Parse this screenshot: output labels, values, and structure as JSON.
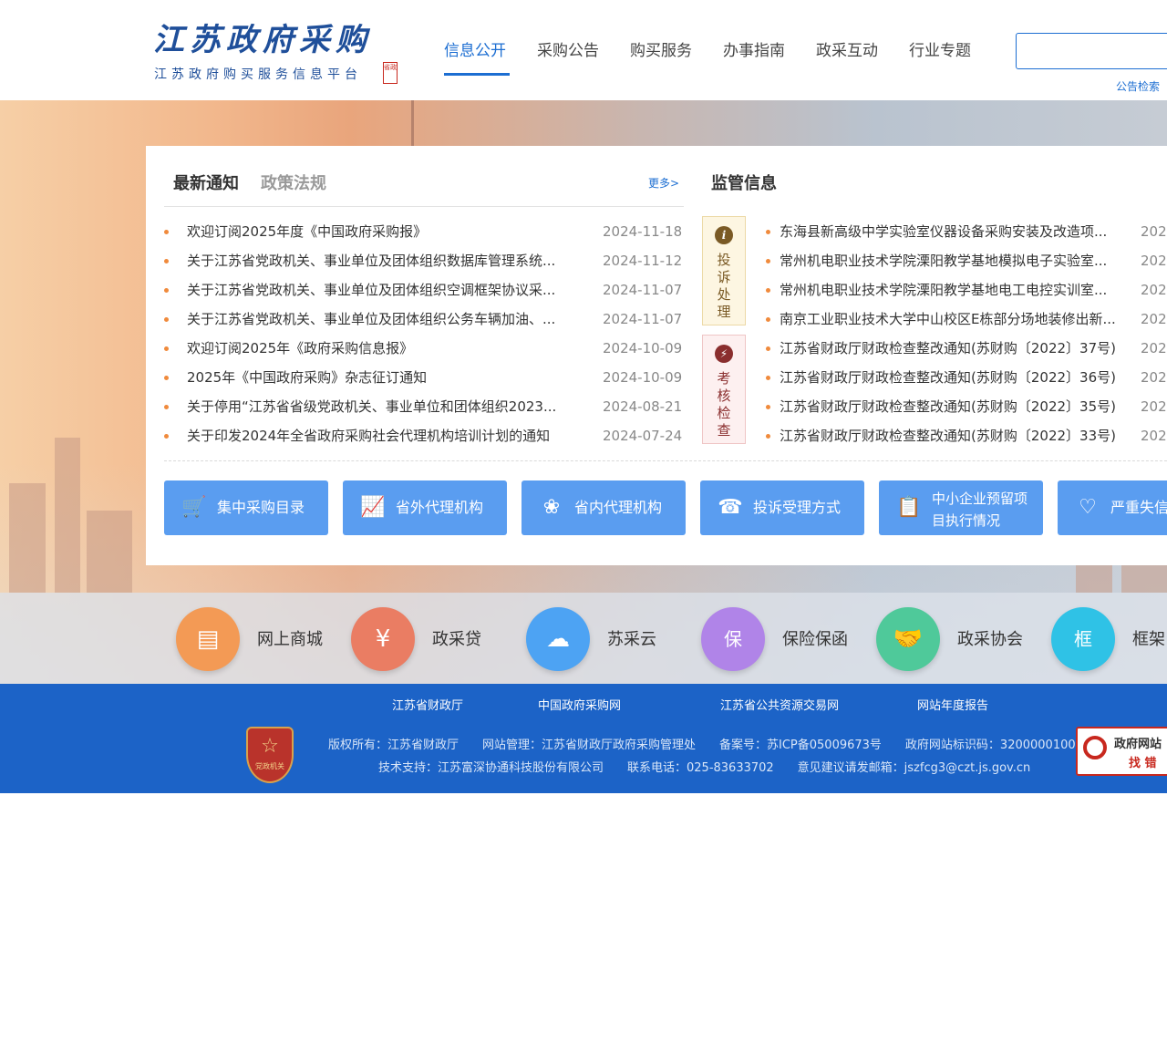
{
  "header": {
    "logo_title": "江苏政府采购",
    "logo_subtitle": "江苏政府购买服务信息平台",
    "logo_seal": "省政",
    "nav": [
      "信息公开",
      "采购公告",
      "购买服务",
      "办事指南",
      "政采互动",
      "行业专题"
    ],
    "active_nav": "信息公开",
    "search_value": "",
    "search_link": "公告检索"
  },
  "notices": {
    "tab_latest": "最新通知",
    "tab_policy": "政策法规",
    "more": "更多>",
    "items": [
      {
        "title": "欢迎订阅2025年度《中国政府采购报》",
        "date": "2024-11-18"
      },
      {
        "title": "关于江苏省党政机关、事业单位及团体组织数据库管理系统...",
        "date": "2024-11-12"
      },
      {
        "title": "关于江苏省党政机关、事业单位及团体组织空调框架协议采...",
        "date": "2024-11-07"
      },
      {
        "title": "关于江苏省党政机关、事业单位及团体组织公务车辆加油、...",
        "date": "2024-11-07"
      },
      {
        "title": "欢迎订阅2025年《政府采购信息报》",
        "date": "2024-10-09"
      },
      {
        "title": "2025年《中国政府采购》杂志征订通知",
        "date": "2024-10-09"
      },
      {
        "title": "关于停用“江苏省省级党政机关、事业单位和团体组织2023...",
        "date": "2024-08-21"
      },
      {
        "title": "关于印发2024年全省政府采购社会代理机构培训计划的通知",
        "date": "2024-07-24"
      }
    ]
  },
  "supervision": {
    "title": "监管信息",
    "box_complaint": "投诉处理",
    "box_assess": "考核检查",
    "items": [
      {
        "title": "东海县新高级中学实验室仪器设备采购安装及改造项...",
        "date": "202"
      },
      {
        "title": "常州机电职业技术学院溧阳教学基地模拟电子实验室...",
        "date": "202"
      },
      {
        "title": "常州机电职业技术学院溧阳教学基地电工电控实训室...",
        "date": "202"
      },
      {
        "title": "南京工业职业技术大学中山校区E栋部分场地装修出新...",
        "date": "202"
      },
      {
        "title": "江苏省财政厅财政检查整改通知(苏财购〔2022〕37号)",
        "date": "202"
      },
      {
        "title": "江苏省财政厅财政检查整改通知(苏财购〔2022〕36号)",
        "date": "202"
      },
      {
        "title": "江苏省财政厅财政检查整改通知(苏财购〔2022〕35号)",
        "date": "202"
      },
      {
        "title": "江苏省财政厅财政检查整改通知(苏财购〔2022〕33号)",
        "date": "202"
      }
    ]
  },
  "quick_links": [
    {
      "label": "集中采购目录",
      "icon": "cart-icon"
    },
    {
      "label": "省外代理机构",
      "icon": "monitor-chart-icon"
    },
    {
      "label": "省内代理机构",
      "icon": "badge-icon"
    },
    {
      "label": "投诉受理方式",
      "icon": "phone-icon"
    },
    {
      "label": "中小企业预留项目执行情况",
      "icon": "clipboard-icon"
    },
    {
      "label": "严重失信",
      "icon": "heart-broken-icon"
    }
  ],
  "services": [
    {
      "label": "网上商城",
      "icon": "shop-icon",
      "color": "#f39a55"
    },
    {
      "label": "政采贷",
      "icon": "loan-icon",
      "color": "#ea7d63"
    },
    {
      "label": "苏采云",
      "icon": "cloud-icon",
      "color": "#4da3f3"
    },
    {
      "label": "保险保函",
      "icon": "insurance-cloud-icon",
      "color": "#b084e8"
    },
    {
      "label": "政采协会",
      "icon": "handshake-icon",
      "color": "#4fc99a"
    },
    {
      "label": "框架",
      "icon": "frame-icon",
      "color": "#2fc2e6"
    }
  ],
  "footer": {
    "links": [
      "江苏省财政厅",
      "中国政府采购网",
      "江苏省公共资源交易网",
      "网站年度报告"
    ],
    "emblem_text": "党政机关",
    "line1": "版权所有：江苏省财政厅　　网站管理：江苏省财政厅政府采购管理处　　备案号：苏ICP备05009673号　　政府网站标识码：3200000100",
    "line2": "技术支持：江苏富深协通科技股份有限公司　　联系电话：025-83633702　　意见建议请发邮箱：jszfcg3@czt.js.gov.cn",
    "finder_line1": "政府网站",
    "finder_line2": "找 错"
  },
  "colors": {
    "brand_blue": "#1c6ed2",
    "footer_blue": "#1c63c7",
    "quick_button": "#5a9df0",
    "bullet": "#f08a3c"
  }
}
